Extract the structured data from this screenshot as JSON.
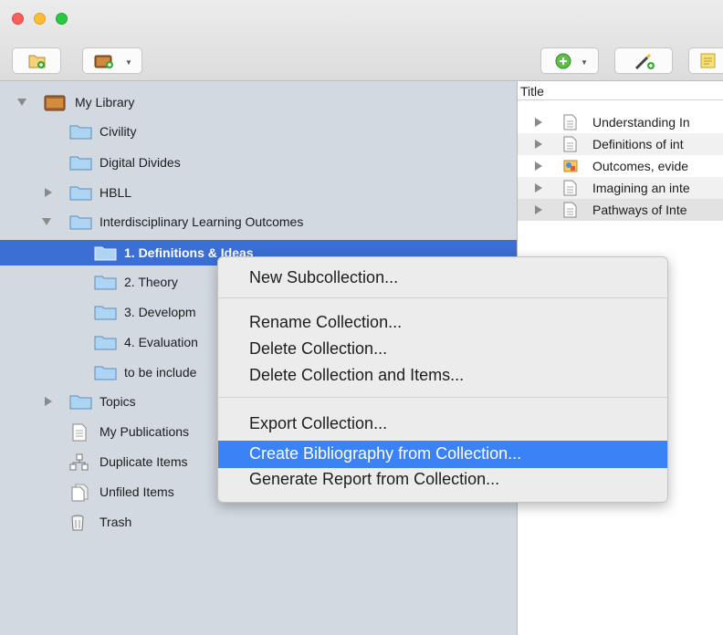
{
  "sidebar": {
    "my_library": "My Library",
    "items": [
      {
        "label": "Civility"
      },
      {
        "label": "Digital Divides"
      },
      {
        "label": "HBLL"
      },
      {
        "label": "Interdisciplinary Learning Outcomes"
      },
      {
        "label": "1. Definitions & Ideas"
      },
      {
        "label": "2. Theory"
      },
      {
        "label": "3. Developm"
      },
      {
        "label": "4. Evaluation"
      },
      {
        "label": "to be include"
      },
      {
        "label": "Topics"
      },
      {
        "label": "My Publications"
      },
      {
        "label": "Duplicate Items"
      },
      {
        "label": "Unfiled Items"
      },
      {
        "label": "Trash"
      }
    ]
  },
  "items_pane": {
    "column_title": "Title",
    "rows": [
      {
        "title": "Understanding In"
      },
      {
        "title": "Definitions of int"
      },
      {
        "title": "Outcomes, evide"
      },
      {
        "title": "Imagining an inte"
      },
      {
        "title": "Pathways of Inte"
      }
    ]
  },
  "context_menu": {
    "items": [
      "New Subcollection...",
      "Rename Collection...",
      "Delete Collection...",
      "Delete Collection and Items...",
      "Export Collection...",
      "Create Bibliography from Collection...",
      "Generate Report from Collection..."
    ],
    "highlighted": "Create Bibliography from Collection..."
  },
  "toolbar": {
    "buttons": [
      "new-collection",
      "new-library",
      "new-item",
      "add-by-identifier",
      "new-note"
    ]
  },
  "colors": {
    "sidebar_bg": "#d2d9e1",
    "selection": "#3b6fd4",
    "menu_highlight": "#3b82f6",
    "close": "#ff5f57",
    "minimize": "#febc2e",
    "zoom": "#28c840"
  }
}
